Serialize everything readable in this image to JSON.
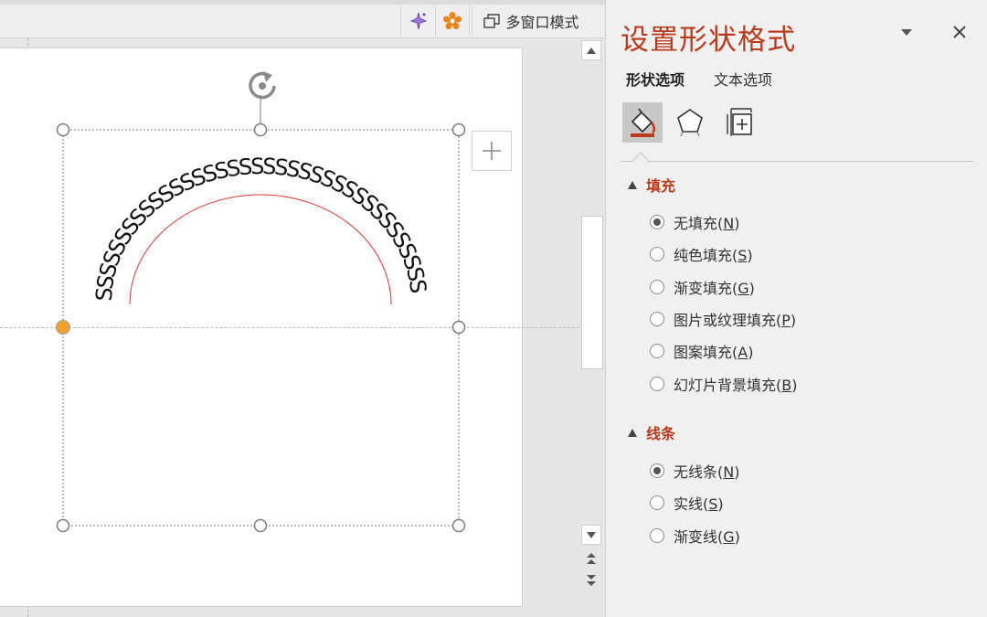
{
  "toolbar": {
    "ai_icon": "magic-sparkle-icon",
    "addin_icon": "gear-flower-icon",
    "multiwindow_label": "多窗口模式",
    "multiwindow_icon": "restore-window-icon"
  },
  "canvas": {
    "shape_text": "SSSSSSSSSSSSSSSSSSSSSSSSSSSSSSSSSSSSS",
    "plus_icon": "plus-icon",
    "rotate_icon": "rotate-handle-icon"
  },
  "pane": {
    "title": "设置形状格式",
    "tabs": [
      "形状选项",
      "文本选项"
    ],
    "categories": [
      "fill-line-icon",
      "effects-pentagon-icon",
      "size-properties-icon"
    ],
    "fill": {
      "label": "填充",
      "options": [
        {
          "text": "无填充(",
          "key": "N",
          "suffix": ")",
          "selected": true
        },
        {
          "text": "纯色填充(",
          "key": "S",
          "suffix": ")",
          "selected": false
        },
        {
          "text": "渐变填充(",
          "key": "G",
          "suffix": ")",
          "selected": false
        },
        {
          "text": "图片或纹理填充(",
          "key": "P",
          "suffix": ")",
          "selected": false
        },
        {
          "text": "图案填充(",
          "key": "A",
          "suffix": ")",
          "selected": false
        },
        {
          "text": "幻灯片背景填充(",
          "key": "B",
          "suffix": ")",
          "selected": false
        }
      ]
    },
    "line": {
      "label": "线条",
      "options": [
        {
          "text": "无线条(",
          "key": "N",
          "suffix": ")",
          "selected": true
        },
        {
          "text": "实线(",
          "key": "S",
          "suffix": ")",
          "selected": false
        },
        {
          "text": "渐变线(",
          "key": "G",
          "suffix": ")",
          "selected": false
        }
      ]
    }
  },
  "colors": {
    "accent": "#b83b1d",
    "handle_yellow": "#f0a030",
    "selection_line": "#7a7a7a"
  }
}
